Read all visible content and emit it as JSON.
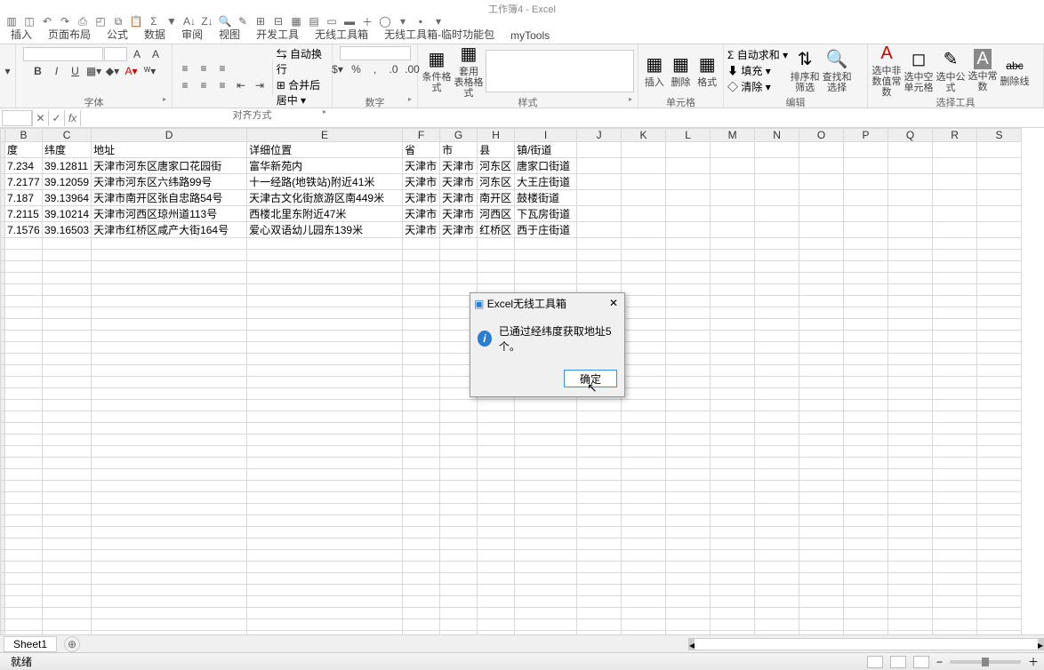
{
  "app": {
    "title": "工作簿4 - Excel"
  },
  "qat_icons": [
    "save",
    "add",
    "undo",
    "redo",
    "print",
    "preview",
    "copy",
    "paste",
    "sum",
    "filter",
    "sort-asc",
    "sort-desc",
    "find",
    "replace",
    "group",
    "ungroup",
    "chart",
    "table",
    "border",
    "fill",
    "plus",
    "add2",
    "f1",
    "f2",
    "dropdown",
    "f3"
  ],
  "tabs": [
    "插入",
    "页面布局",
    "公式",
    "数据",
    "审阅",
    "视图",
    "开发工具",
    "无线工具箱",
    "无线工具箱-临时功能包",
    "myTools"
  ],
  "ribbon": {
    "font": {
      "label": "字体",
      "bold": "B",
      "italic": "I",
      "underline": "U",
      "fontsize": "",
      "a_big": "A",
      "a_small": "A"
    },
    "align": {
      "label": "对齐方式",
      "wrap": "自动换行",
      "merge": "合并后居中"
    },
    "number": {
      "label": "数字"
    },
    "styles": {
      "label": "样式",
      "cond": "条件格式",
      "tbl": "套用\n表格格式"
    },
    "cells": {
      "label": "单元格",
      "insert": "插入",
      "delete": "删除",
      "format": "格式"
    },
    "edit": {
      "label": "编辑",
      "autosum": "自动求和",
      "fill": "填充",
      "clear": "清除",
      "sort": "排序和筛选",
      "find": "查找和选择"
    },
    "seltools": {
      "label": "选择工具",
      "sel1": "选中非\n数值常数",
      "sel2": "选中空\n单元格",
      "sel3": "选中公式",
      "sel4": "选中常数",
      "sel5": "删除线"
    }
  },
  "namebox": "",
  "columns": [
    "B",
    "C",
    "D",
    "E",
    "F",
    "G",
    "H",
    "I",
    "J",
    "K",
    "L",
    "M",
    "N",
    "O",
    "P",
    "Q",
    "R",
    "S"
  ],
  "headers": [
    "度",
    "纬度",
    "地址",
    "详细位置",
    "省",
    "市",
    "县",
    "镇/街道"
  ],
  "rows": [
    [
      "7.234",
      "39.12811",
      "天津市河东区唐家口花园街",
      "富华新苑内",
      "天津市",
      "天津市",
      "河东区",
      "唐家口街道"
    ],
    [
      "7.2177",
      "39.12059",
      "天津市河东区六纬路99号",
      "十一经路(地铁站)附近41米",
      "天津市",
      "天津市",
      "河东区",
      "大王庄街道"
    ],
    [
      "7.187",
      "39.13964",
      "天津市南开区张自忠路54号",
      "天津古文化街旅游区南449米",
      "天津市",
      "天津市",
      "南开区",
      "鼓楼街道"
    ],
    [
      "7.2115",
      "39.10214",
      "天津市河西区琼州道113号",
      "西楼北里东附近47米",
      "天津市",
      "天津市",
      "河西区",
      "下瓦房街道"
    ],
    [
      "7.1576",
      "39.16503",
      "天津市红桥区咸产大街164号",
      "爱心双语幼儿园东139米",
      "天津市",
      "天津市",
      "红桥区",
      "西于庄街道"
    ]
  ],
  "sheet_tab": "Sheet1",
  "dialog": {
    "title": "Excel无线工具箱",
    "message": "已通过经纬度获取地址5个。",
    "ok": "确定"
  },
  "status": {
    "ready": "就绪"
  }
}
